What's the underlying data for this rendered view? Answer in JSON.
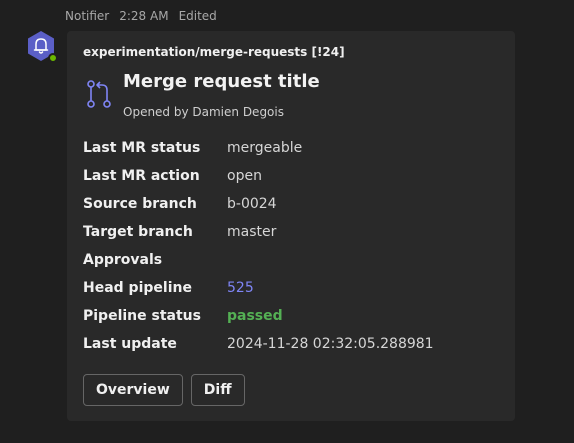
{
  "message": {
    "sender": "Notifier",
    "time": "2:28 AM",
    "edited": "Edited"
  },
  "card": {
    "repo": "experimentation/merge-requests [!24]",
    "title": "Merge request title",
    "opened_by": "Opened by Damien Degois",
    "facts": [
      {
        "key": "Last MR status",
        "value": "mergeable"
      },
      {
        "key": "Last MR action",
        "value": "open"
      },
      {
        "key": "Source branch",
        "value": "b-0024"
      },
      {
        "key": "Target branch",
        "value": "master"
      },
      {
        "key": "Approvals",
        "value": ""
      },
      {
        "key": "Head pipeline",
        "value": "525"
      },
      {
        "key": "Pipeline status",
        "value": "passed"
      },
      {
        "key": "Last update",
        "value": "2024-11-28 02:32:05.288981"
      }
    ],
    "actions": {
      "overview": "Overview",
      "diff": "Diff"
    }
  },
  "colors": {
    "background": "#1f1f1f",
    "card": "#292929",
    "link": "#7f85f5",
    "passed": "#54b054",
    "avatar": "#5b5fc7",
    "presence": "#6bb700"
  },
  "icons": {
    "avatar": "bot-bell-icon",
    "merge_request": "merge-request-icon"
  }
}
